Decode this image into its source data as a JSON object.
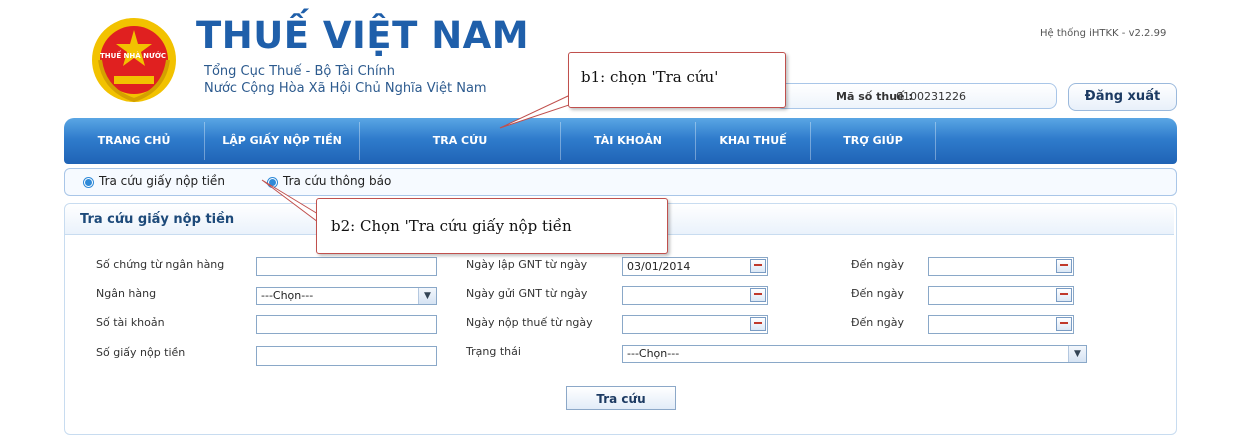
{
  "header": {
    "brand_title": "THUẾ VIỆT NAM",
    "brand_sub1": "Tổng Cục Thuế - Bộ Tài Chính",
    "brand_sub2": "Nước Cộng Hòa Xã Hội Chủ Nghĩa Việt Nam",
    "version": "Hệ thống iHTKK - v2.2.99",
    "mst_label": "Mã số thuế :",
    "mst_value": "0100231226",
    "logout_label": "Đăng xuất",
    "emblem_text": "THUẾ NHÀ NƯỚC"
  },
  "nav": {
    "items": [
      "TRANG CHỦ",
      "LẬP GIẤY NỘP TIỀN",
      "TRA CỨU",
      "TÀI KHOẢN",
      "KHAI THUẾ",
      "TRỢ GIÚP"
    ]
  },
  "subnav": {
    "items": [
      "Tra cứu giấy nộp tiền",
      "Tra cứu thông báo"
    ]
  },
  "panel": {
    "title": "Tra cứu giấy nộp tiền",
    "labels": {
      "so_chung_tu": "Số chứng từ ngân hàng",
      "ngan_hang": "Ngân hàng",
      "so_tai_khoan": "Số tài khoản",
      "so_giay": "Số giấy nộp tiền",
      "ngay_lap": "Ngày lập GNT từ ngày",
      "ngay_gui": "Ngày gửi GNT từ ngày",
      "ngay_nop": "Ngày nộp thuế từ ngày",
      "trang_thai": "Trạng thái",
      "den_ngay": "Đến ngày"
    },
    "values": {
      "ngay_lap_from": "03/01/2014",
      "bank_select": "---Chọn---",
      "status_select": "---Chọn---"
    },
    "search_label": "Tra cứu"
  },
  "callouts": {
    "b1": "b1: chọn 'Tra cứu'",
    "b2": "b2: Chọn 'Tra cứu giấy nộp tiền"
  },
  "icons": {
    "calendar": "calendar-icon",
    "dropdown": "chevron-down-icon",
    "bullet": "bullet-icon"
  },
  "colors": {
    "nav_top": "#5aa6e4",
    "nav_bottom": "#1f63b5",
    "brand_blue": "#1f5faa",
    "callout_border": "#c0504d"
  }
}
